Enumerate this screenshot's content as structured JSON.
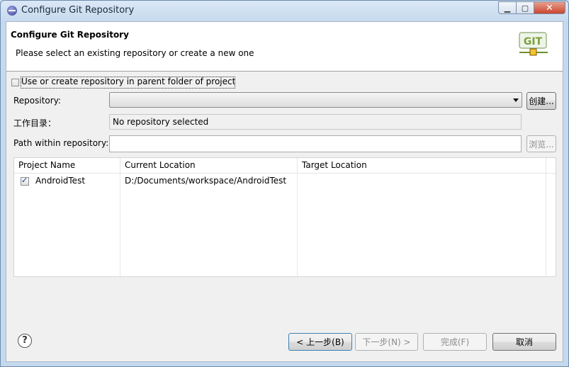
{
  "window": {
    "title": "Configure Git Repository"
  },
  "header": {
    "title": "Configure Git Repository",
    "message": "Please select an existing repository or create a new one"
  },
  "options": {
    "parent_folder_label": "Use or create repository in parent folder of project",
    "parent_folder_checked": false
  },
  "repository": {
    "label": "Repository:",
    "value": "",
    "create_button": "创建..."
  },
  "workdir": {
    "label": "工作目录：",
    "value": "No repository selected"
  },
  "path": {
    "label": "Path within repository:",
    "value": "",
    "browse_button": "浏览..."
  },
  "table": {
    "columns": [
      "Project Name",
      "Current Location",
      "Target Location"
    ],
    "rows": [
      {
        "checked": true,
        "project": "AndroidTest",
        "current": "D:/Documents/workspace/AndroidTest",
        "target": ""
      }
    ]
  },
  "buttons": {
    "back": "< 上一步(B)",
    "next": "下一步(N) >",
    "finish": "完成(F)",
    "cancel": "取消"
  },
  "icons": {
    "help": "help-icon",
    "logo": "git-logo-icon",
    "app": "eclipse-icon"
  }
}
